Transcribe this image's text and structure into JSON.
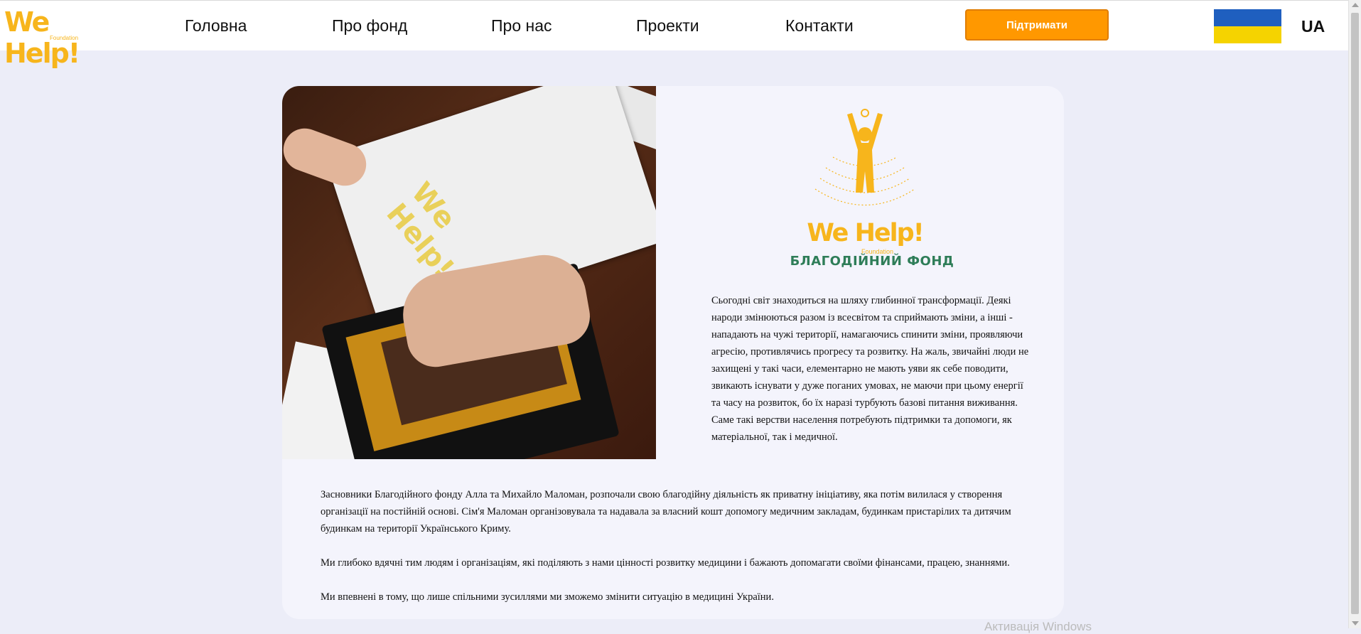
{
  "header": {
    "logo": {
      "text": "We Help!",
      "sub": "Foundation"
    },
    "nav": [
      {
        "label": "Головна",
        "name": "nav-item-home"
      },
      {
        "label": "Про фонд",
        "name": "nav-item-about-fund"
      },
      {
        "label": "Про нас",
        "name": "nav-item-about-us"
      },
      {
        "label": "Проекти",
        "name": "nav-item-projects"
      },
      {
        "label": "Контакти",
        "name": "nav-item-contacts"
      }
    ],
    "support_label": "Підтримати",
    "language": "UA",
    "flag_icon": "ukraine-flag-icon"
  },
  "card": {
    "logo": {
      "text": "We Help!",
      "sub": "Foundation"
    },
    "title": "БЛАГОДІЙНИЙ ФОНД",
    "intro": "Сьогодні світ знаходиться на шляху глибинної трансформації. Деякі народи змінюються разом із всесвітом та сприймають зміни, а інші -  нападають на чужі території, намагаючись спинити зміни, проявляючи агресію, противлячись прогресу та розвитку. На жаль, звичайні люди не захищені у такі часи, елементарно не мають уяви як себе поводити, звикають існувати у дуже поганих умовах, не маючи при цьому енергії та часу на розвиток, бо їх наразі турбують базові питання виживання. Саме такі верстви населення потребують підтримки та допомоги, як матеріальної, так і медичної.",
    "paragraph1": "Засновники Благодійного фонду Алла та Михайло Маломан, розпочали свою благодійну діяльність як приватну ініціативу, яка потім вилилася у створення організації на постійній основі. Сім'я Маломан організовувала та надавала за власний кошт допомогу медичним закладам, будинкам пристарілих та дитячим будинкам на території  Українського Криму.",
    "paragraph2": "Ми глибоко вдячні тим людям і організаціям, які поділяють з нами цінності розвитку медицини і бажають допомагати своїми фінансами, працею, знаннями.",
    "paragraph3": "Ми впевнені в тому, що лише спільними зусиллями ми зможемо змінити ситуацію в медицині України."
  },
  "colors": {
    "accent": "#ff9800",
    "brand_yellow": "#f7b51c",
    "title_green": "#2e7d58",
    "page_bg": "#ecedf8"
  },
  "watermark": "Активація Windows"
}
